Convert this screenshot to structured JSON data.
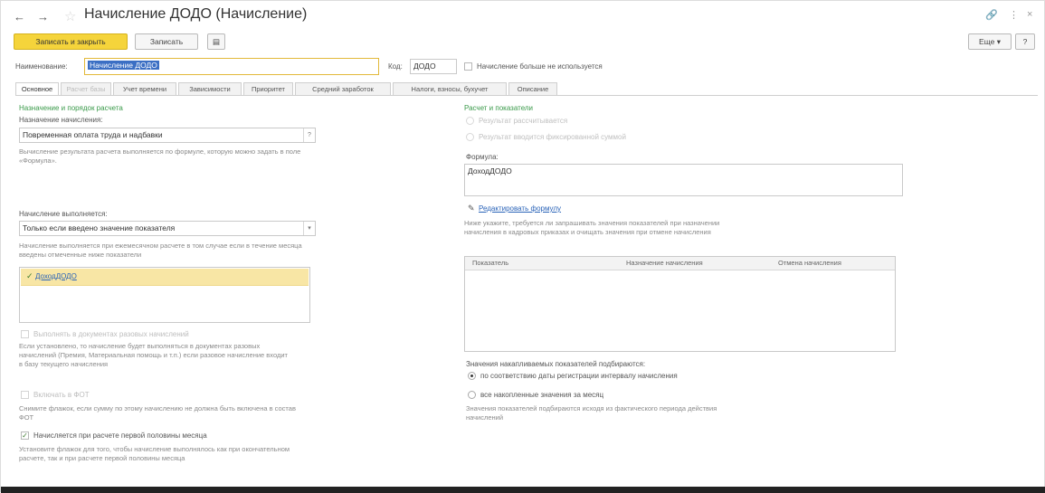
{
  "window": {
    "title": "Начисление ДОДО (Начисление)",
    "star_icon": "star-icon",
    "back_icon": "arrow-left-icon",
    "forward_icon": "arrow-right-icon",
    "link_icon": "link-icon",
    "more_icon": "vertical-dots-icon",
    "close_icon": "close-icon"
  },
  "toolbar": {
    "save_close_label": "Записать и закрыть",
    "save_label": "Записать",
    "doc_icon": "document-icon",
    "more_label": "Еще",
    "help_label": "?"
  },
  "header": {
    "name_label": "Наименование:",
    "name_value": "Начисление ДОДО",
    "code_label": "Код:",
    "code_value": "ДОДО",
    "not_used_label": "Начисление больше не используется",
    "not_used_checked": false
  },
  "tabs": [
    {
      "label": "Основное",
      "active": true,
      "disabled": false
    },
    {
      "label": "Расчет базы",
      "active": false,
      "disabled": true
    },
    {
      "label": "Учет времени",
      "active": false,
      "disabled": false
    },
    {
      "label": "Зависимости",
      "active": false,
      "disabled": false
    },
    {
      "label": "Приоритет",
      "active": false,
      "disabled": false
    },
    {
      "label": "Средний заработок",
      "active": false,
      "disabled": false
    },
    {
      "label": "Налоги, взносы, бухучет",
      "active": false,
      "disabled": false
    },
    {
      "label": "Описание",
      "active": false,
      "disabled": false
    }
  ],
  "left": {
    "section_title": "Назначение и порядок расчета",
    "purpose_label": "Назначение начисления:",
    "purpose_value": "Повременная оплата труда и надбавки",
    "purpose_hint": "Вычисление результата расчета выполняется по формуле, которую можно задать в поле «Формула».",
    "performed_label": "Начисление выполняется:",
    "performed_value": "Только если введено значение показателя",
    "performed_hint": "Начисление выполняется при ежемесячном расчете в том случае если в течение месяца введены отмеченные ниже показатели",
    "indicators": [
      "ДоходДОДО"
    ],
    "separate_docs_label": "Выполнять в документах разовых начислений",
    "separate_docs_hint": "Если установлено, то начисление будет выполняться в документах разовых начислений (Премия, Материальная помощь и т.п.) если разовое начисление входит в базу текущего начисления",
    "fot_label": "Включать в ФОТ",
    "fot_hint": "Снимите флажок, если сумму по этому начислению не должна быть включена в состав ФОТ",
    "first_half_label": "Начисляется при расчете первой половины месяца",
    "first_half_checked": true,
    "first_half_hint": "Установите флажок для того, чтобы начисление выполнялось как при окончательном расчете, так и при расчете первой половины месяца"
  },
  "right": {
    "section_title": "Расчет и показатели",
    "result_calc_label": "Результат рассчитывается",
    "result_fixed_label": "Результат вводится фиксированной суммой",
    "formula_label": "Формула:",
    "formula_value": "ДоходДОДО",
    "edit_formula_label": "Редактировать формулу",
    "edit_icon": "pencil-icon",
    "indicators_hint": "Ниже укажите, требуется ли запрашивать значения показателей при назначении начисления в кадровых приказах и очищать значения при отмене начисления",
    "table_headers": [
      "Показатель",
      "Назначение начисления",
      "Отмена начисления"
    ],
    "table_rows": [],
    "accum_label": "Значения накапливаемых показателей подбираются:",
    "accum_opt1": "по соответствию даты регистрации интервалу начисления",
    "accum_opt2": "все накопленные значения за месяц",
    "accum_selected": 0,
    "accum_hint": "Значения показателей подбираются исходя из фактического периода действия начислений"
  }
}
